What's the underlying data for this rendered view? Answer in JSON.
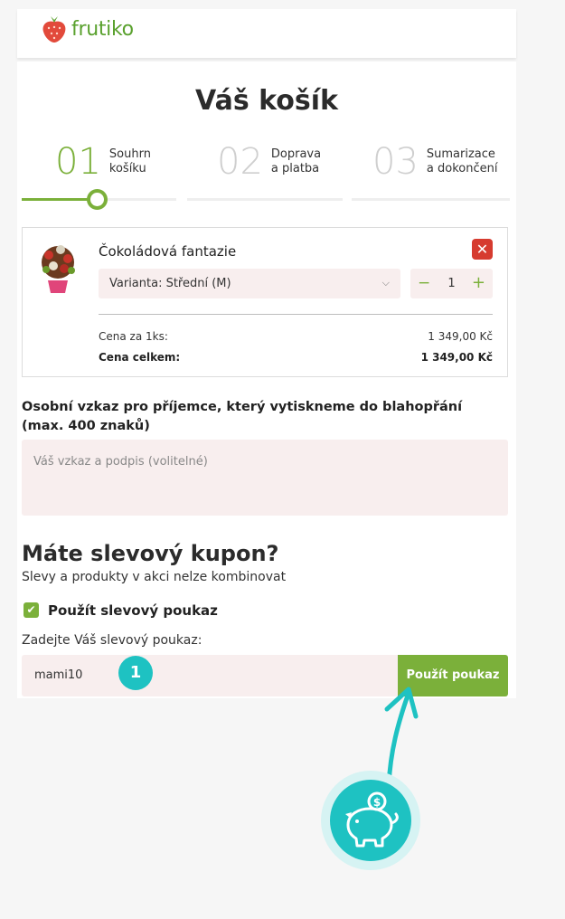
{
  "brand": {
    "name": "frutiko"
  },
  "page": {
    "title": "Váš košík"
  },
  "steps": [
    {
      "number": "01",
      "label_line1": "Souhrn",
      "label_line2": "košíku"
    },
    {
      "number": "02",
      "label_line1": "Doprava",
      "label_line2": "a platba"
    },
    {
      "number": "03",
      "label_line1": "Sumarizace",
      "label_line2": "a dokončení"
    }
  ],
  "cart_item": {
    "name": "Čokoládová fantazie",
    "variant": "Varianta: Střední (M)",
    "quantity": "1",
    "unit_price_label": "Cena za 1ks:",
    "unit_price": "1 349,00 Kč",
    "total_label": "Cena celkem:",
    "total": "1 349,00 Kč"
  },
  "message": {
    "label": "Osobní vzkaz pro příjemce, který vytiskneme do blahopřání (max. 400 znaků)",
    "placeholder": "Váš vzkaz a podpis (volitelné)"
  },
  "coupon": {
    "title": "Máte slevový kupon?",
    "subtitle": "Slevy a produkty v akci nelze kombinovat",
    "checkbox_label": "Použít slevový poukaz",
    "field_label": "Zadejte Váš slevový poukaz:",
    "value": "mami10",
    "button_label": "Použít poukaz"
  },
  "annotation": {
    "badge": "1"
  },
  "icons": {
    "logo": "strawberry-icon",
    "remove": "close-icon",
    "select": "chevron-down-icon",
    "check": "check-icon",
    "piggy": "piggy-bank-icon"
  },
  "colors": {
    "accent": "#7bb03a",
    "danger": "#d63b2f",
    "annotation": "#1ec2c2",
    "field_bg": "#f8eeee"
  }
}
